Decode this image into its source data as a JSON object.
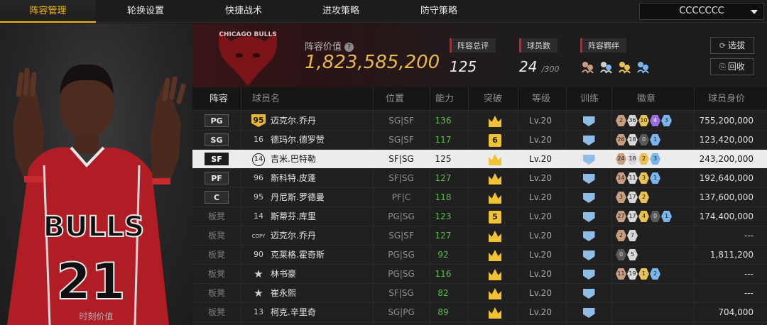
{
  "nav": {
    "tabs": [
      "阵容管理",
      "轮换设置",
      "快捷战术",
      "进攻策略",
      "防守策略"
    ],
    "active_tab": 0,
    "account": "CCCCCCC"
  },
  "player_panel": {
    "caption": "时刻价值",
    "jersey_team": "BULLS",
    "jersey_number": "21"
  },
  "header": {
    "logo_text": "CHICAGO BULLS",
    "team_value_label": "阵容价值",
    "team_value": "1,823,585,200",
    "overall_label": "阵容总评",
    "overall_value": "125",
    "count_label": "球员数",
    "count_value": "24",
    "count_max": "/300",
    "bond_label": "阵容羁绊",
    "select_btn": "选拔",
    "recycle_btn": "回收"
  },
  "table": {
    "headers": {
      "pos": "阵容",
      "name": "球员名",
      "slot": "位置",
      "ability": "能力",
      "breakthrough": "突破",
      "level": "等级",
      "training": "训练",
      "badges": "徽章",
      "salary": "球员身价"
    },
    "rows": [
      {
        "pos": "PG",
        "num": "95",
        "num_style": "gold",
        "name": "迈克尔.乔丹",
        "slot": "SG|SF",
        "ability": "136",
        "brk": "",
        "lv": "Lv.20",
        "badges": [
          [
            "b-bronze",
            "2"
          ],
          [
            "b-silver",
            "36"
          ],
          [
            "b-gold",
            "10"
          ],
          [
            "b-purple",
            "4"
          ],
          [
            "b-blue",
            "3"
          ]
        ],
        "salary": "755,200,000",
        "selected": false,
        "bench": false
      },
      {
        "pos": "SG",
        "num": "16",
        "num_style": "plain",
        "name": "德玛尔.德罗赞",
        "slot": "SG|SF",
        "ability": "117",
        "brk": "6",
        "lv": "Lv.20",
        "badges": [
          [
            "b-bronze",
            "26"
          ],
          [
            "b-silver",
            "18"
          ],
          [
            "b-dark",
            "0"
          ],
          [
            "b-blue",
            "1"
          ]
        ],
        "salary": "123,420,000",
        "selected": false,
        "bench": false
      },
      {
        "pos": "SF",
        "num": "14",
        "num_style": "hex",
        "name": "吉米.巴特勒",
        "slot": "SF|SG",
        "ability": "125",
        "brk": "",
        "lv": "Lv.20",
        "badges": [
          [
            "b-bronze",
            "24"
          ],
          [
            "b-silver",
            "18"
          ],
          [
            "b-gold",
            "2"
          ],
          [
            "b-blue",
            "3"
          ]
        ],
        "salary": "243,200,000",
        "selected": true,
        "bench": false
      },
      {
        "pos": "PF",
        "num": "96",
        "num_style": "plain",
        "name": "斯科特.皮蓬",
        "slot": "SF|SG",
        "ability": "127",
        "brk": "",
        "lv": "Lv.20",
        "badges": [
          [
            "b-bronze",
            "14"
          ],
          [
            "b-silver",
            "11"
          ],
          [
            "b-gold",
            "3"
          ],
          [
            "b-blue",
            "1"
          ]
        ],
        "salary": "192,640,000",
        "selected": false,
        "bench": false
      },
      {
        "pos": "C",
        "num": "95",
        "num_style": "plain",
        "name": "丹尼斯.罗德曼",
        "slot": "PF|C",
        "ability": "118",
        "brk": "",
        "lv": "Lv.20",
        "badges": [
          [
            "b-bronze",
            "3"
          ],
          [
            "b-silver",
            "17"
          ],
          [
            "b-gold",
            "2"
          ]
        ],
        "salary": "137,600,000",
        "selected": false,
        "bench": false
      },
      {
        "pos": "板凳",
        "num": "14",
        "num_style": "plain",
        "name": "斯蒂芬.库里",
        "slot": "PG|SG",
        "ability": "123",
        "brk": "5",
        "lv": "Lv.20",
        "badges": [
          [
            "b-bronze",
            "27"
          ],
          [
            "b-silver",
            "17"
          ],
          [
            "b-gold",
            "4"
          ],
          [
            "b-dark",
            "0"
          ],
          [
            "b-blue",
            "1"
          ]
        ],
        "salary": "174,400,000",
        "selected": false,
        "bench": true
      },
      {
        "pos": "板凳",
        "num": "COPY",
        "num_style": "copy",
        "name": "迈克尔.乔丹",
        "slot": "SG|SF",
        "ability": "127",
        "brk": "",
        "lv": "Lv.20",
        "badges": [
          [
            "b-bronze",
            "2"
          ],
          [
            "b-silver",
            "7"
          ]
        ],
        "salary": "---",
        "selected": false,
        "bench": true
      },
      {
        "pos": "板凳",
        "num": "90",
        "num_style": "plain",
        "name": "克莱格.霍奇斯",
        "slot": "PG|SG",
        "ability": "92",
        "brk": "",
        "lv": "Lv.20",
        "badges": [
          [
            "b-dark",
            "0"
          ],
          [
            "b-silver",
            "5"
          ]
        ],
        "salary": "1,811,200",
        "selected": false,
        "bench": true
      },
      {
        "pos": "板凳",
        "num": "★",
        "num_style": "star",
        "name": "林书豪",
        "slot": "PG|SG",
        "ability": "116",
        "brk": "",
        "lv": "Lv.20",
        "badges": [
          [
            "b-bronze",
            "11"
          ],
          [
            "b-silver",
            "19"
          ],
          [
            "b-gold",
            "1"
          ],
          [
            "b-blue",
            "2"
          ]
        ],
        "salary": "---",
        "selected": false,
        "bench": true
      },
      {
        "pos": "板凳",
        "num": "★",
        "num_style": "star",
        "name": "崔永熙",
        "slot": "SF|SG",
        "ability": "82",
        "brk": "",
        "lv": "Lv.20",
        "badges": [],
        "salary": "---",
        "selected": false,
        "bench": true
      },
      {
        "pos": "板凳",
        "num": "13",
        "num_style": "plain",
        "name": "柯克.辛里奇",
        "slot": "SG|PG",
        "ability": "89",
        "brk": "",
        "lv": "Lv.20",
        "badges": [],
        "salary": "704,000",
        "selected": false,
        "bench": true
      }
    ]
  },
  "colors": {
    "accent_gold": "#f5b800",
    "value_gold": "#e8b94a",
    "ability_green": "#5bbd4a",
    "bulls_red": "#c8202a"
  }
}
